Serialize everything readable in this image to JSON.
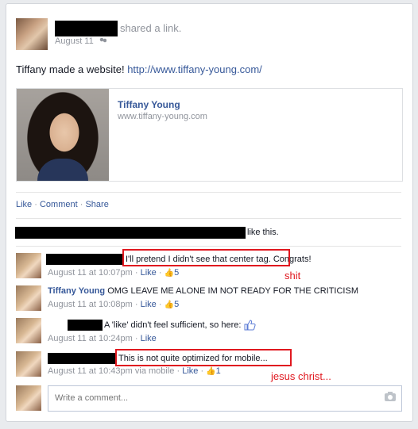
{
  "post": {
    "action_text": "shared a link.",
    "date": "August 11",
    "message_prefix": "Tiffany made a website!",
    "message_url": "http://www.tiffany-young.com/"
  },
  "preview": {
    "title": "Tiffany Young",
    "domain": "www.tiffany-young.com"
  },
  "actions": {
    "like": "Like",
    "comment": "Comment",
    "share": "Share",
    "sep": "·"
  },
  "likes_summary": {
    "text": "like this."
  },
  "comments": [
    {
      "author": "",
      "text": "I'll pretend I didn't see that center tag.",
      "text_suffix": " Congrats!",
      "time": "August 11 at 10:07pm",
      "like_label": "Like",
      "like_count": "5",
      "annotation": "shit"
    },
    {
      "author": "Tiffany Young",
      "text": "OMG LEAVE ME ALONE IM NOT READY FOR THE CRITICISM",
      "time": "August 11 at 10:08pm",
      "like_label": "Like",
      "like_count": "5"
    },
    {
      "author": "",
      "text": "A 'like' didn't feel sufficient, so here:",
      "time": "August 11 at 10:24pm",
      "like_label": "Like"
    },
    {
      "author": "",
      "text": "This is not quite optimized for mobile...",
      "time": "August 11 at 10:43pm",
      "via": "via mobile",
      "like_label": "Like",
      "like_count": "1",
      "annotation": "jesus christ..."
    }
  ],
  "composer": {
    "placeholder": "Write a comment..."
  },
  "colors": {
    "link": "#365899",
    "annotation_red": "#e0181f",
    "redaction": "#000000"
  },
  "icons": [
    "friends-audience-icon",
    "thumbs-up-icon",
    "camera-icon"
  ]
}
